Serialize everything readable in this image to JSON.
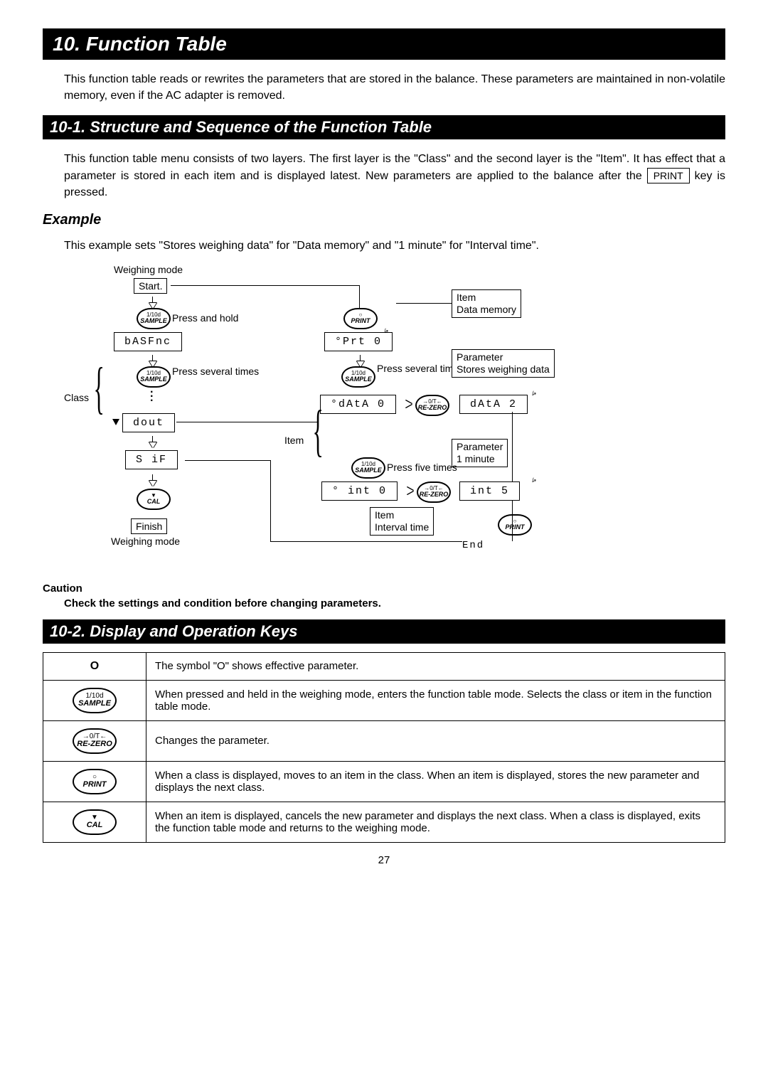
{
  "page_number": "27",
  "title": "10. Function Table",
  "intro": "This function table reads or rewrites the parameters that are stored in the balance. These parameters are maintained in non-volatile memory, even if the AC adapter is removed.",
  "section1": {
    "heading": "10-1.  Structure and Sequence of the Function Table",
    "body_pre": "This function table menu consists of two layers. The first layer is the \"Class\" and the second layer is the \"Item\". It has effect that a parameter is stored in each item and is displayed latest. New parameters are applied to the balance after the ",
    "print_key": "PRINT",
    "body_post": " key is pressed."
  },
  "example": {
    "heading": "Example",
    "text": "This example sets \"Stores weighing data\" for \"Data memory\" and \"1 minute\" for \"Interval time\"."
  },
  "diagram": {
    "weighing_mode_top": "Weighing mode",
    "start": "Start.",
    "press_and_hold": "Press and hold",
    "press_several_times": "Press several times",
    "press_five_times": "Press five times",
    "class_label": "Class",
    "item_label": "Item",
    "item_data_memory": "Data memory",
    "parameter_label": "Parameter",
    "stores_weighing_data": "Stores weighing data",
    "one_minute": "1 minute",
    "interval_time": "Interval time",
    "finish": "Finish",
    "weighing_mode_bottom": "Weighing mode",
    "seg_basfnc": "bASFnc",
    "seg_dout": "dout",
    "seg_sif": "S iF",
    "seg_prt": "°Prt   0",
    "seg_data0": "°dAtA  0",
    "seg_data2": "dAtA  2",
    "seg_int0": "° int   0",
    "seg_int5": " int   5",
    "seg_end": "End",
    "key_sample_top": "1/10d",
    "key_sample_bot": "SAMPLE",
    "key_print_top": "○",
    "key_print_bot": "PRINT",
    "key_rezero_top": "→0/T←",
    "key_rezero_bot": "RE-ZERO",
    "key_cal_top": "▼",
    "key_cal_bot": "CAL"
  },
  "caution": {
    "heading": "Caution",
    "text": "Check the settings and condition before changing parameters."
  },
  "section2": {
    "heading": "10-2.  Display and Operation Keys"
  },
  "table": {
    "row0": {
      "icon": "O",
      "desc": "The symbol \"O\" shows effective parameter."
    },
    "row1": {
      "top": "1/10d",
      "bot": "SAMPLE",
      "desc": "When pressed and held in the weighing mode, enters the function table mode. Selects the class or item in the function table mode."
    },
    "row2": {
      "top": "→0/T←",
      "bot": "RE-ZERO",
      "desc": "Changes the parameter."
    },
    "row3": {
      "top": "○",
      "bot": "PRINT",
      "desc": "When a class is displayed, moves to an item in the class. When an item is displayed, stores the new parameter and displays the next class."
    },
    "row4": {
      "top": "▼",
      "bot": "CAL",
      "desc": "When an item is displayed, cancels the new parameter and displays the next class. When a class is displayed, exits the function table mode and returns to the weighing mode."
    }
  }
}
